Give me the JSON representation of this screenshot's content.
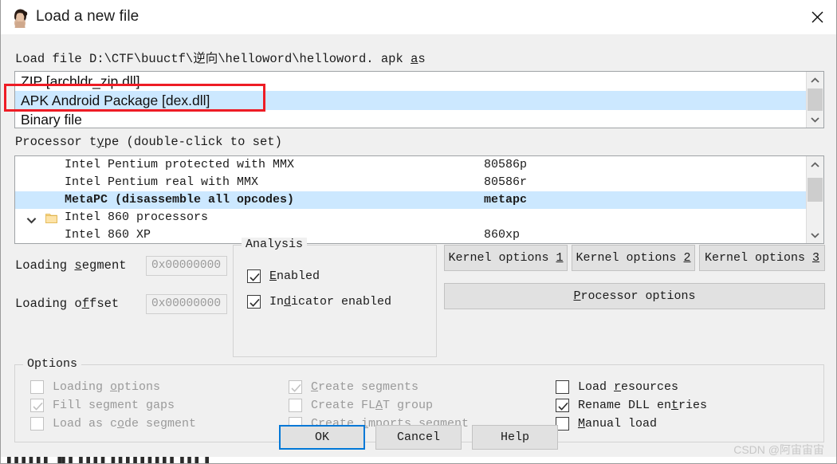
{
  "window": {
    "title": "Load a new file",
    "icon": "ida-woman-icon",
    "close_label": "✕"
  },
  "file_prompt": {
    "prefix": "Load file ",
    "path": "D:\\CTF\\buuctf\\逆向\\helloword\\helloword. apk",
    "suffix_mnemonic": "a",
    "suffix_rest": "s"
  },
  "format_list": {
    "rows": [
      {
        "label": "ZIP [archldr_zip.dll]",
        "selected": false
      },
      {
        "label": "APK Android Package [dex.dll]",
        "selected": true
      },
      {
        "label": "Binary file",
        "selected": false
      }
    ],
    "scroll": {
      "up": "⌃",
      "down": "⌄"
    }
  },
  "processor": {
    "label_pre": "Processor t",
    "label_mn": "y",
    "label_post": "pe (double-click to set)",
    "rows": [
      {
        "name": "Intel Pentium protected with MMX",
        "code": "80586p",
        "selected": false,
        "folder": false,
        "expander": false
      },
      {
        "name": "Intel Pentium real with MMX",
        "code": "80586r",
        "selected": false,
        "folder": false,
        "expander": false
      },
      {
        "name": "MetaPC (disassemble all opcodes)",
        "code": "metapc",
        "selected": true,
        "folder": false,
        "expander": false
      },
      {
        "name": "Intel 860 processors",
        "code": "",
        "selected": false,
        "folder": true,
        "expander": true
      },
      {
        "name": "Intel 860 XP",
        "code": "860xp",
        "selected": false,
        "folder": false,
        "expander": false
      }
    ]
  },
  "loading": {
    "segment_label_pre": "Loading ",
    "segment_label_mn": "s",
    "segment_label_post": "egment",
    "segment_value": "0x00000000",
    "offset_label_pre": "Loading o",
    "offset_label_mn": "f",
    "offset_label_post": "fset",
    "offset_value": "0x00000000"
  },
  "analysis": {
    "title": "Analysis",
    "items": [
      {
        "pre": "",
        "mn": "E",
        "post": "nabled",
        "checked": true,
        "disabled": false
      },
      {
        "pre": "In",
        "mn": "d",
        "post": "icator enabled",
        "checked": true,
        "disabled": false
      }
    ]
  },
  "kernel_buttons": [
    {
      "pre": "Kernel options ",
      "mn": "1",
      "post": ""
    },
    {
      "pre": "Kernel options ",
      "mn": "2",
      "post": ""
    },
    {
      "pre": "Kernel options ",
      "mn": "3",
      "post": ""
    }
  ],
  "processor_options_button": {
    "pre": "",
    "mn": "P",
    "post": "rocessor options"
  },
  "options": {
    "title": "Options",
    "column1": [
      {
        "pre": "Loading ",
        "mn": "o",
        "post": "ptions",
        "checked": false,
        "disabled": true
      },
      {
        "pre": "Fill se",
        "mn": "g",
        "post": "ment gaps",
        "checked": true,
        "disabled": true
      },
      {
        "pre": "Load as c",
        "mn": "o",
        "post": "de segment",
        "checked": false,
        "disabled": true
      }
    ],
    "column2": [
      {
        "pre": "",
        "mn": "C",
        "post": "reate segments",
        "checked": true,
        "disabled": true
      },
      {
        "pre": "Create FL",
        "mn": "A",
        "post": "T group",
        "checked": false,
        "disabled": true
      },
      {
        "pre": "Create ",
        "mn": "i",
        "post": "mports segment",
        "checked": false,
        "disabled": true
      }
    ],
    "column3": [
      {
        "pre": "Load ",
        "mn": "r",
        "post": "esources",
        "checked": false,
        "disabled": false
      },
      {
        "pre": "Rename DLL en",
        "mn": "t",
        "post": "ries",
        "checked": true,
        "disabled": false
      },
      {
        "pre": "",
        "mn": "M",
        "post": "anual load",
        "checked": false,
        "disabled": false
      }
    ]
  },
  "footer_buttons": [
    {
      "label": "OK",
      "focused": true
    },
    {
      "label": "Cancel",
      "focused": false
    },
    {
      "label": "Help",
      "focused": false
    }
  ],
  "watermark": "CSDN @阿宙宙宙",
  "colors": {
    "selection": "#cce8ff",
    "annotation": "#ee1c25",
    "focus": "#0078d7",
    "dialog_bg": "#f0f0f0"
  }
}
